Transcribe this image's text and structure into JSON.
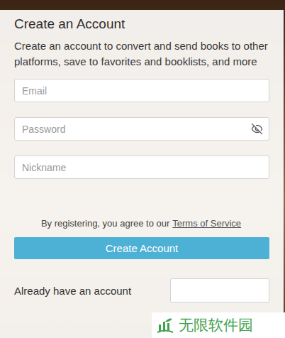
{
  "dialog": {
    "title": "Create an Account",
    "description": "Create an account to convert and send books to other platforms, save to favorites and booklists, and more"
  },
  "fields": [
    {
      "placeholder": "Email",
      "kind": "text"
    },
    {
      "placeholder": "Password",
      "kind": "password"
    },
    {
      "placeholder": "Nickname",
      "kind": "text"
    }
  ],
  "terms": {
    "text": "By registering, you agree to our",
    "link": "Terms of Service"
  },
  "submit": "Create Account",
  "footer": {
    "text": "Already have an account"
  },
  "watermark": {
    "text": "无限软件园"
  }
}
